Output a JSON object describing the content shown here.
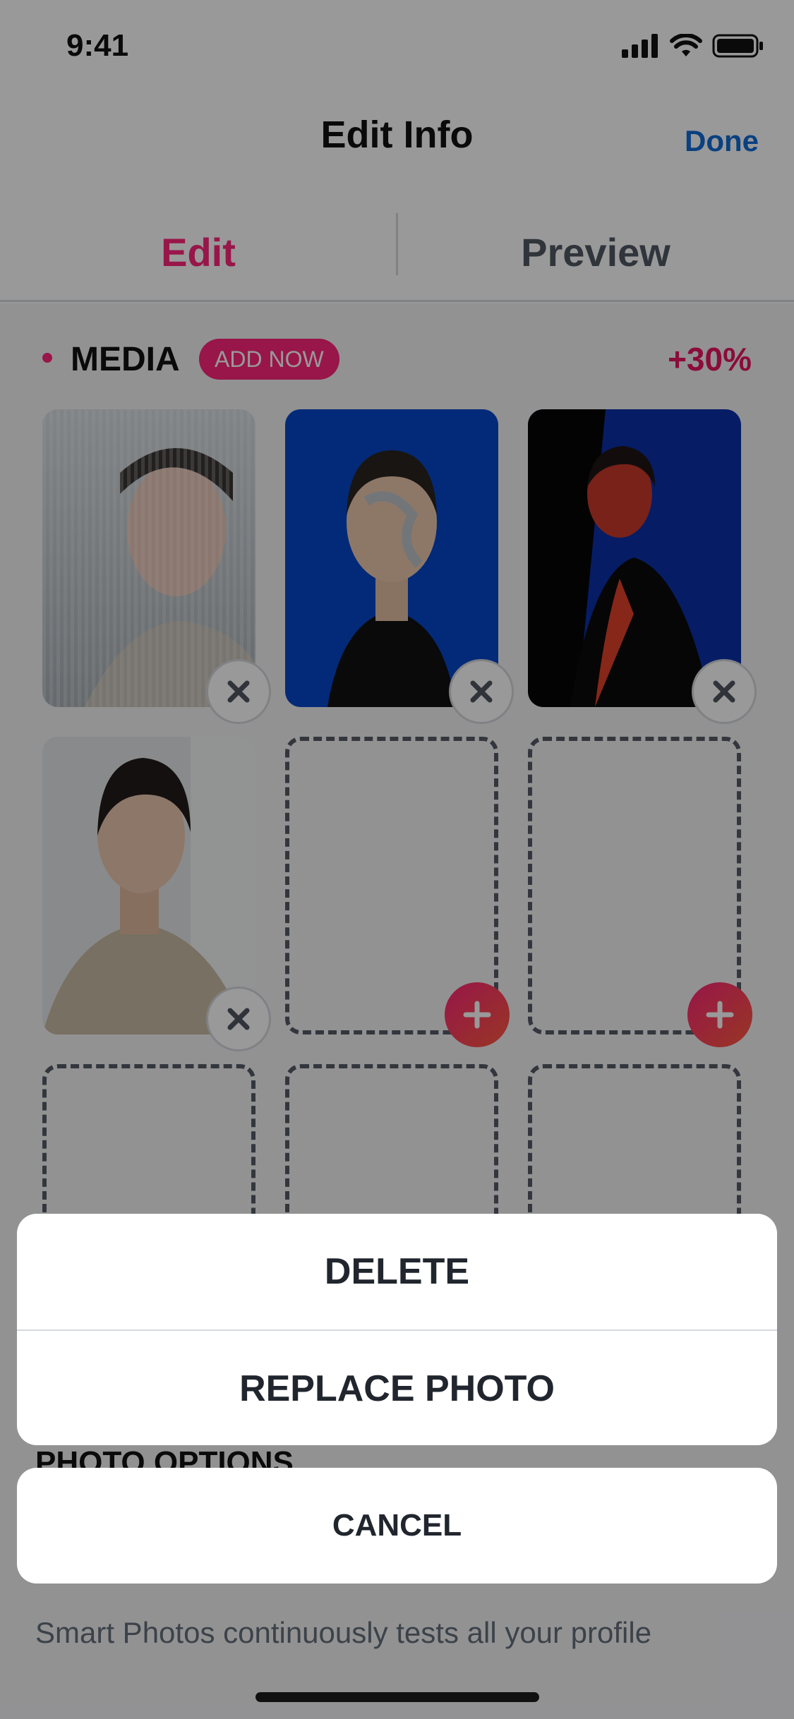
{
  "status_bar": {
    "time": "9:41"
  },
  "nav": {
    "title": "Edit Info",
    "done_label": "Done"
  },
  "tabs": [
    {
      "label": "Edit"
    },
    {
      "label": "Preview"
    }
  ],
  "media": {
    "label": "MEDIA",
    "badge": "ADD NOW",
    "percent": "+30%"
  },
  "section": {
    "photo_options": "PHOTO OPTIONS"
  },
  "smart_photos": {
    "text": "Smart Photos continuously tests all your profile"
  },
  "action_sheet": {
    "delete_label": "DELETE",
    "replace_label": "REPLACE PHOTO",
    "cancel_label": "CANCEL"
  },
  "colors": {
    "accent": "#fd267a",
    "done": "#106bd5",
    "text": "#21262e"
  }
}
